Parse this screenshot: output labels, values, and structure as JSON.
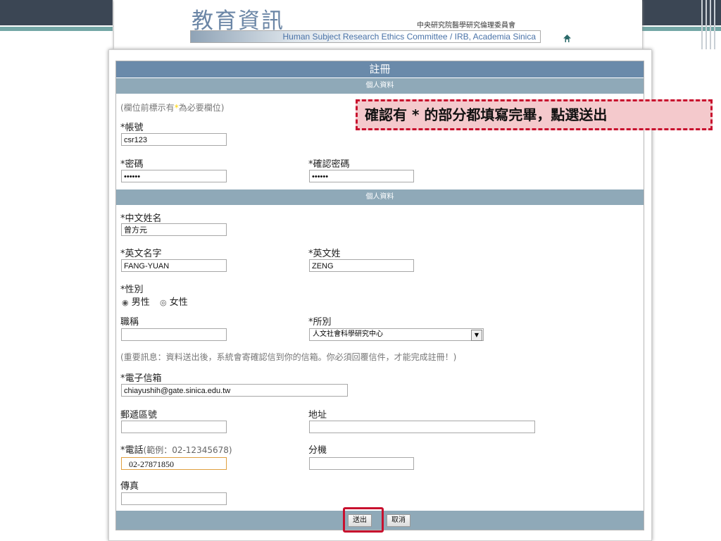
{
  "header": {
    "logo_title": "教育資訊",
    "org_name": "中央研究院醫學研究倫理委員會",
    "subtitle": "Human Subject Research Ethics Committee / IRB, Academia Sinica"
  },
  "form": {
    "title": "註冊",
    "section1": "個人資料",
    "required_note_pre": "(欄位前標示有",
    "required_note_star": "*",
    "required_note_post": "為必要欄位)",
    "account": {
      "label": "*帳號",
      "value": "csr123"
    },
    "password": {
      "label": "*密碼",
      "value": "••••••"
    },
    "confirm_password": {
      "label": "*確認密碼",
      "value": "••••••"
    },
    "section2": "個人資料",
    "chinese_name": {
      "label": "*中文姓名",
      "value": "曾方元"
    },
    "english_first": {
      "label": "*英文名字",
      "value": "FANG-YUAN"
    },
    "english_last": {
      "label": "*英文姓",
      "value": "ZENG"
    },
    "gender": {
      "label": "*性別",
      "male": "男性",
      "female": "女性",
      "selected": "男性"
    },
    "job_title": {
      "label": "職稱",
      "value": ""
    },
    "institute": {
      "label": "*所別",
      "value": "人文社會科學研究中心"
    },
    "important_note": "(重要訊息：資料送出後，系統會寄確認信到你的信箱。你必須回覆信件，才能完成註冊！)",
    "email": {
      "label": "*電子信箱",
      "value": "chiayushih@gate.sinica.edu.tw"
    },
    "postal_code": {
      "label": "郵遞區號",
      "value": ""
    },
    "address": {
      "label": "地址",
      "value": ""
    },
    "phone": {
      "label": "*電話",
      "hint": "(範例：02-12345678)",
      "value": "02-27871850"
    },
    "extension": {
      "label": "分機",
      "value": ""
    },
    "fax": {
      "label": "傳真",
      "value": ""
    },
    "submit_label": "送出",
    "cancel_label": "取消"
  },
  "callout": {
    "text": "確認有 * 的部分都填寫完畢，點選送出"
  },
  "colors": {
    "title_bar": "#6a8aaa",
    "section_bar": "#8fa9b8",
    "highlight": "#c8102e",
    "callout_bg": "#f4c9cc"
  }
}
